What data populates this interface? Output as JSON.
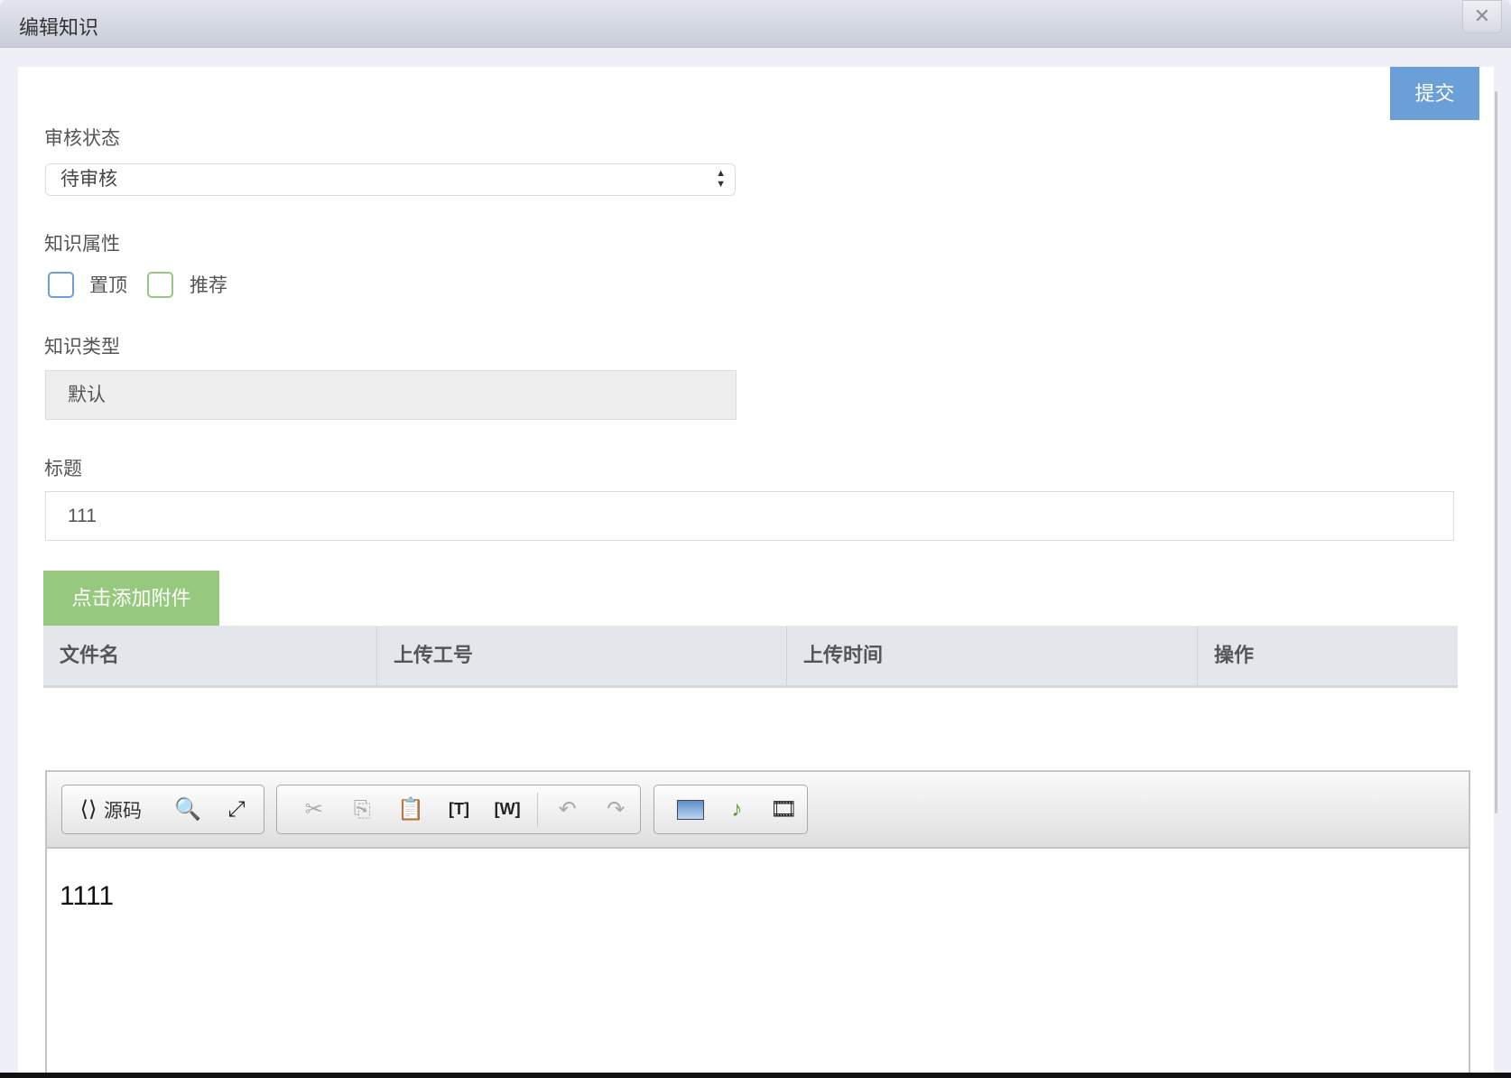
{
  "dialog": {
    "title": "编辑知识",
    "close_icon": "close-icon"
  },
  "submit_label": "提交",
  "review": {
    "label": "审核状态",
    "value": "待审核"
  },
  "attributes": {
    "label": "知识属性",
    "options": [
      {
        "label": "置顶",
        "checked": false,
        "color": "#6a9fd8"
      },
      {
        "label": "推荐",
        "checked": false,
        "color": "#96c97d"
      }
    ]
  },
  "type": {
    "label": "知识类型",
    "value": "默认"
  },
  "title": {
    "label": "标题",
    "value": "111"
  },
  "attachment": {
    "button": "点击添加附件",
    "columns": [
      "文件名",
      "上传工号",
      "上传时间",
      "操作"
    ]
  },
  "editor": {
    "source_label": "源码",
    "content": "1111"
  }
}
